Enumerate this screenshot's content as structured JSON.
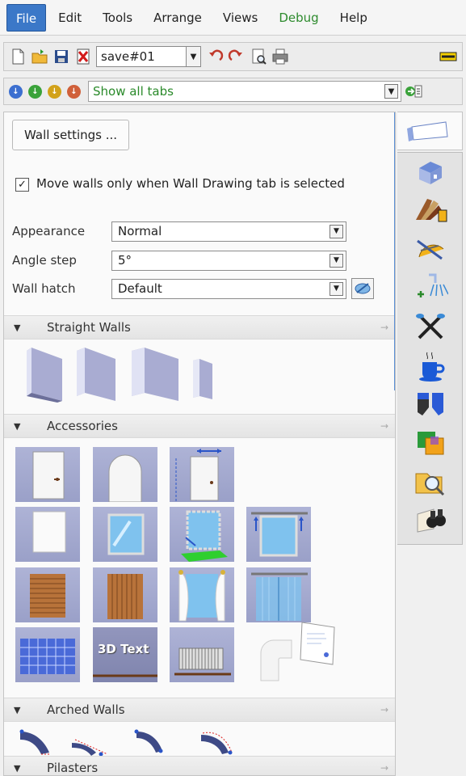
{
  "menubar": {
    "items": [
      "File",
      "Edit",
      "Tools",
      "Arrange",
      "Views",
      "Debug",
      "Help"
    ]
  },
  "toolbar": {
    "save_combo_value": "save#01"
  },
  "filterbar": {
    "tab_filter_value": "Show all tabs"
  },
  "panel": {
    "wall_settings_label": "Wall settings ...",
    "move_walls_label": "Move walls only when Wall Drawing tab is selected",
    "move_walls_checked": true,
    "appearance_label": "Appearance",
    "appearance_value": "Normal",
    "angle_step_label": "Angle step",
    "angle_step_value": "5°",
    "wall_hatch_label": "Wall hatch",
    "wall_hatch_value": "Default",
    "sections": [
      "Straight Walls",
      "Accessories",
      "Arched Walls",
      "Pilasters"
    ],
    "text_tile_label": "3D Text"
  },
  "colors": {
    "accent": "#3b78c8",
    "debug_text": "#2e8b2e",
    "filter_text": "#2a8a2a"
  },
  "right_tabs": [
    "wall-drawing-icon",
    "house-3d-icon",
    "materials-icon",
    "measure-icon",
    "plumbing-icon",
    "tools-icon",
    "coffee-cup-icon",
    "slippers-icon",
    "color-squares-icon",
    "folder-search-icon",
    "binoculars-icon"
  ]
}
